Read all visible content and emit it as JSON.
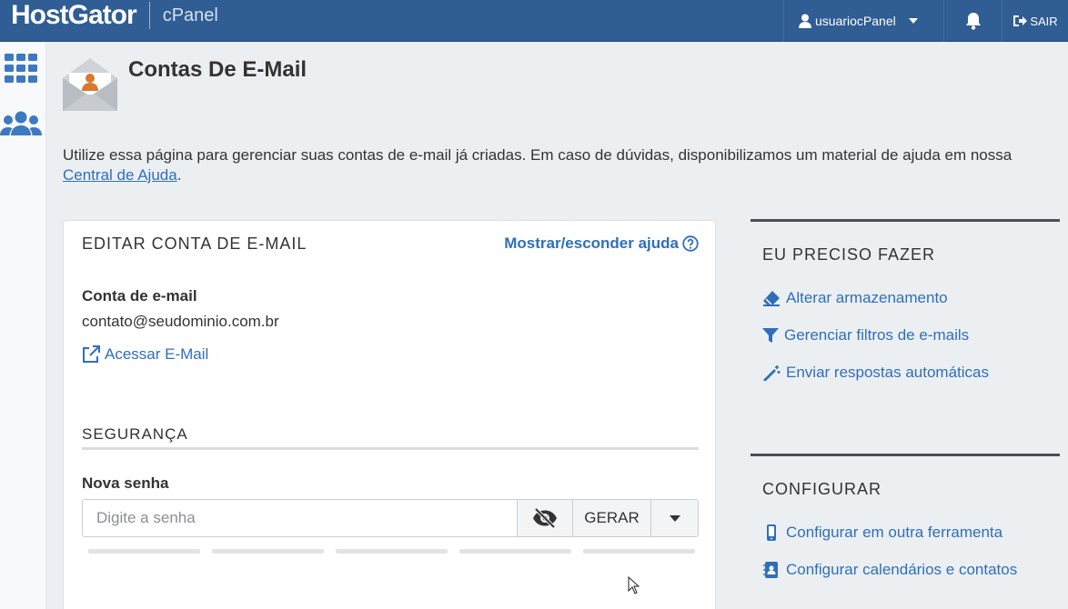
{
  "header": {
    "brand": "HostGator",
    "product": "cPanel",
    "user": "usuariocPanel",
    "logout": "SAIR",
    "icons": [
      "user-icon",
      "caret-down-icon",
      "bell-icon",
      "logout-icon"
    ]
  },
  "sidebar": {
    "icons": [
      "grid-icon",
      "users-icon"
    ]
  },
  "page": {
    "title": "Contas De E-Mail",
    "intro_text": "Utilize essa página para gerenciar suas contas de e-mail já criadas. Em caso de dúvidas, disponibilizamos um material de ajuda em nossa ",
    "intro_link": "Central de Ajuda",
    "intro_end": "."
  },
  "edit_panel": {
    "heading": "EDITAR CONTA DE E-MAIL",
    "help_toggle": "Mostrar/esconder ajuda",
    "account_label": "Conta de e-mail",
    "account_value": "contato@seudominio.com.br",
    "access_link": "Acessar E-Mail",
    "security_heading": "SEGURANÇA",
    "password_label": "Nova senha",
    "password_placeholder": "Digite a senha",
    "generate_button": "GERAR",
    "strength_segments": 5
  },
  "actions": {
    "heading": "EU PRECISO FAZER",
    "links": [
      {
        "label": "Alterar armazenamento",
        "icon": "eraser-icon"
      },
      {
        "label": "Gerenciar filtros de e-mails",
        "icon": "filter-icon"
      },
      {
        "label": "Enviar respostas automáticas",
        "icon": "magic-wand-icon"
      }
    ]
  },
  "configure": {
    "heading": "CONFIGURAR",
    "links": [
      {
        "label": "Configurar em outra ferramenta",
        "icon": "mobile-icon"
      },
      {
        "label": "Configurar calendários e contatos",
        "icon": "address-book-icon"
      }
    ]
  },
  "colors": {
    "header_bg": "#2f5d94",
    "link": "#2f6fba",
    "page_bg": "#eceff2"
  }
}
